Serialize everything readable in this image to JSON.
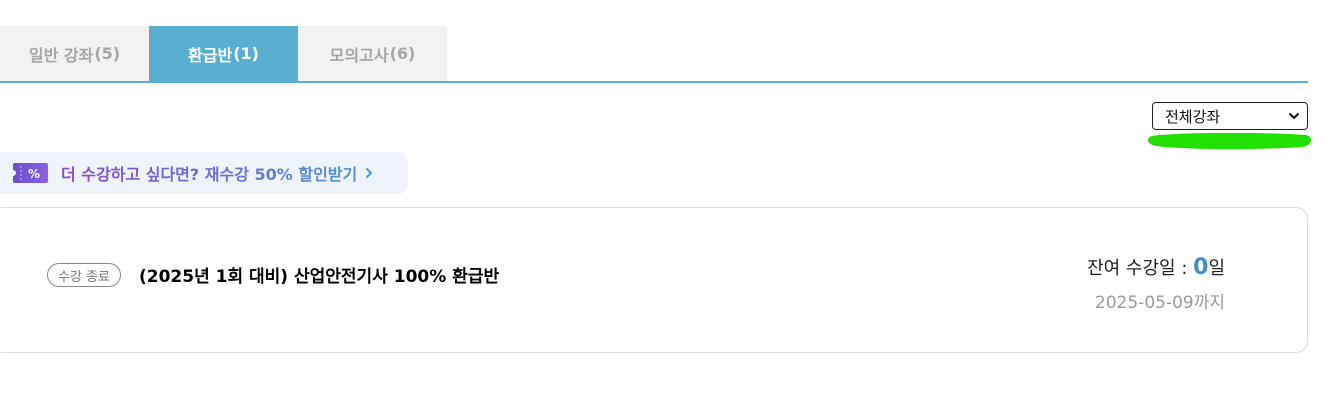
{
  "tabs": [
    {
      "label": "일반 강좌",
      "count": "(5)",
      "active": false
    },
    {
      "label": "환급반",
      "count": "(1)",
      "active": true
    },
    {
      "label": "모의고사",
      "count": "(6)",
      "active": false
    }
  ],
  "filter": {
    "selected": "전체강좌"
  },
  "promo": {
    "coupon_icon_text": "%",
    "text": "더 수강하고 싶다면? 재수강 50% 할인받기"
  },
  "course": {
    "status": "수강 종료",
    "title": "(2025년 1회 대비) 산업안전기사 100% 환급반",
    "remaining_label": "잔여 수강일 : ",
    "remaining_days": "0",
    "remaining_unit": "일",
    "end_date": "2025-05-09",
    "end_suffix": "까지"
  },
  "colors": {
    "accent": "#5aaed2",
    "highlight_mark": "#22e000",
    "days_number": "#3e8fc8"
  }
}
